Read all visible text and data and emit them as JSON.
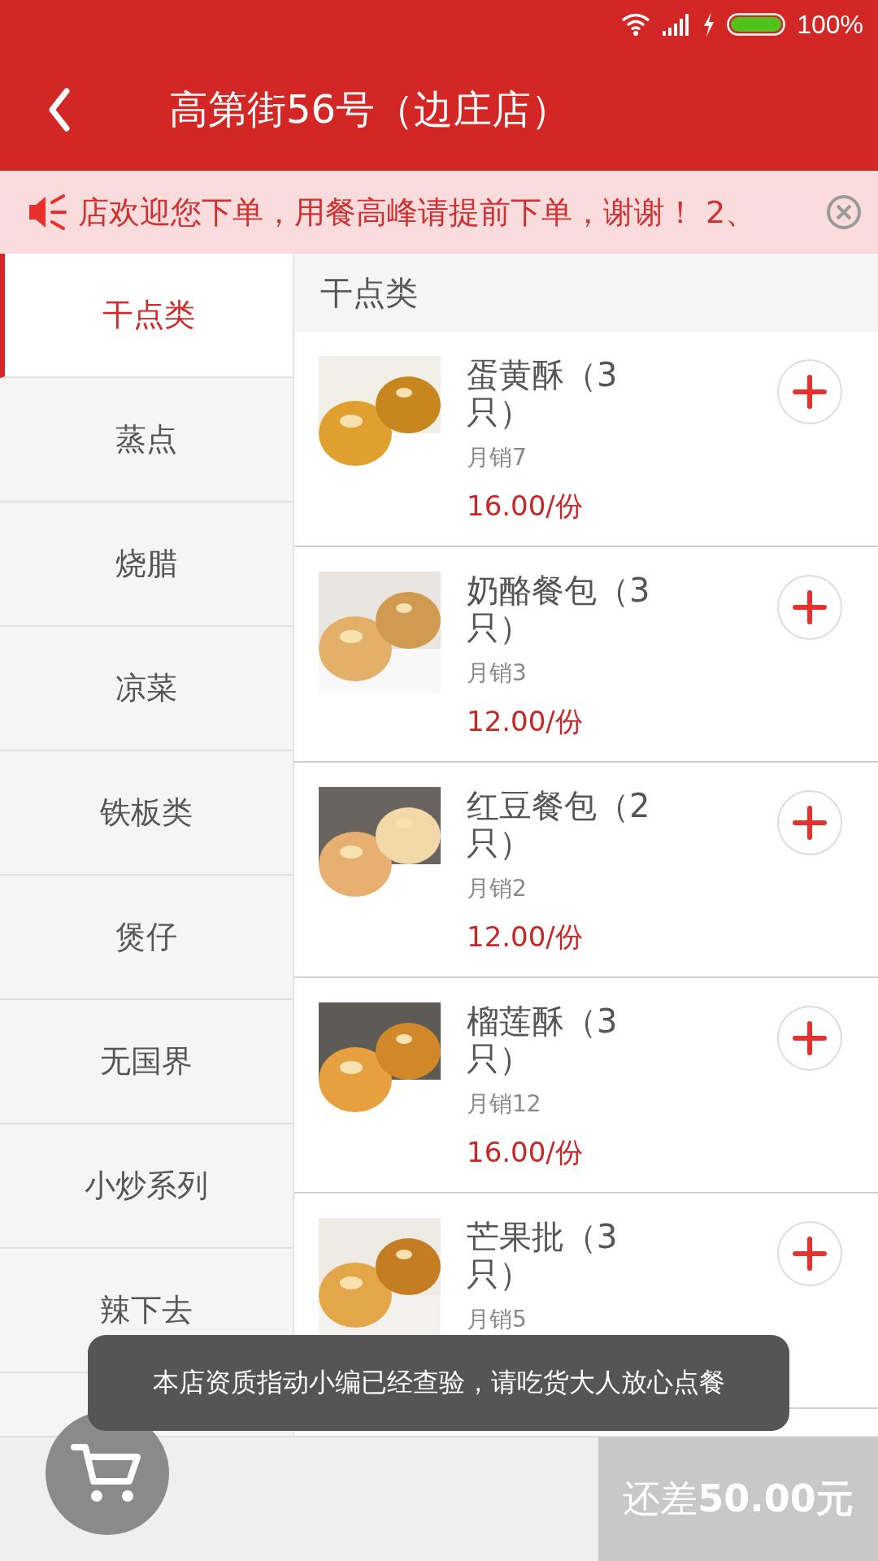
{
  "status_bar": {
    "battery_text": "100%"
  },
  "header": {
    "title": "高第街56号（边庄店）"
  },
  "notice": {
    "text": "店欢迎您下单，用餐高峰请提前下单，谢谢！ 2、"
  },
  "categories": [
    {
      "label": "干点类",
      "selected": true
    },
    {
      "label": "蒸点",
      "selected": false
    },
    {
      "label": "烧腊",
      "selected": false
    },
    {
      "label": "凉菜",
      "selected": false
    },
    {
      "label": "铁板类",
      "selected": false
    },
    {
      "label": "煲仔",
      "selected": false
    },
    {
      "label": "无国界",
      "selected": false
    },
    {
      "label": "小炒系列",
      "selected": false
    },
    {
      "label": "辣下去",
      "selected": false
    }
  ],
  "section_title": "干点类",
  "products": [
    {
      "name": "蛋黄酥（3只）",
      "sales": "月销7",
      "price": "16.00/份"
    },
    {
      "name": "奶酪餐包（3只）",
      "sales": "月销3",
      "price": "12.00/份"
    },
    {
      "name": "红豆餐包（2只）",
      "sales": "月销2",
      "price": "12.00/份"
    },
    {
      "name": "榴莲酥（3只）",
      "sales": "月销12",
      "price": "16.00/份"
    },
    {
      "name": "芒果批（3只）",
      "sales": "月销5"
    }
  ],
  "toast": "本店资质指动小编已经查验，请吃货大人放心点餐",
  "checkout": {
    "label": "还差**50.00元**"
  }
}
